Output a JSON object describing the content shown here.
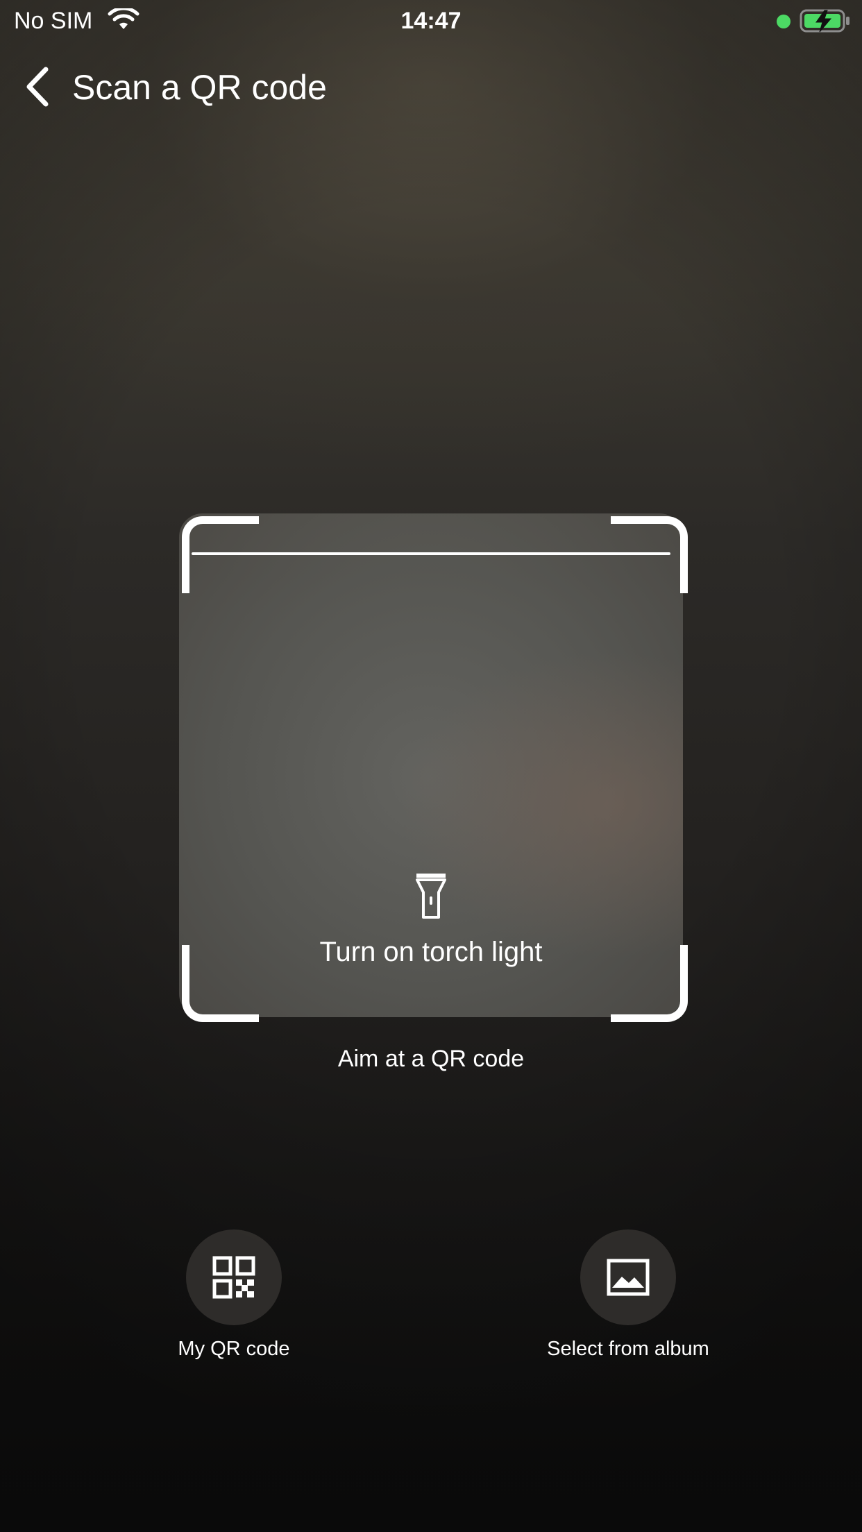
{
  "status_bar": {
    "carrier": "No SIM",
    "time": "14:47"
  },
  "nav": {
    "title": "Scan a QR code",
    "back_icon": "chevron-left-icon"
  },
  "scanner": {
    "torch_label": "Turn on torch light",
    "torch_icon": "flashlight-icon",
    "hint": "Aim at a QR code"
  },
  "actions": [
    {
      "label": "My QR code",
      "icon": "qr-code-icon"
    },
    {
      "label": "Select from album",
      "icon": "image-icon"
    }
  ],
  "colors": {
    "camera_indicator": "#4cd964",
    "battery_fill": "#4cd964",
    "text": "#ffffff"
  }
}
